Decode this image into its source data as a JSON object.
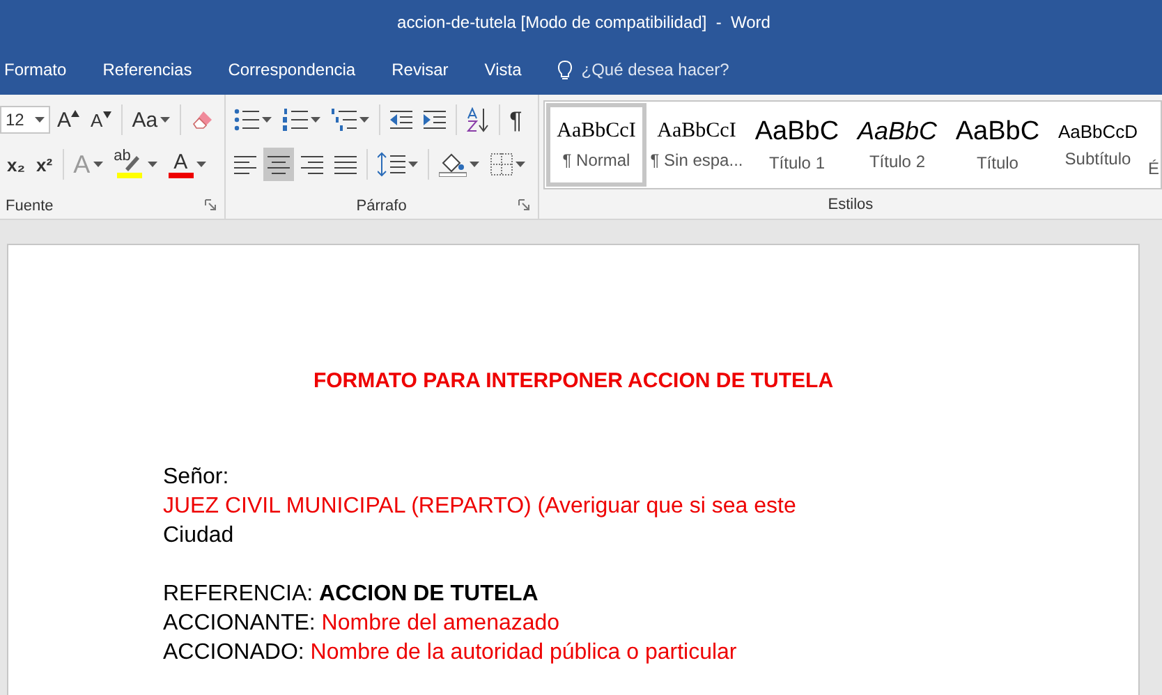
{
  "window": {
    "title": "accion-de-tutela [Modo de compatibilidad]  -  Word"
  },
  "tabs": [
    {
      "label": "Formato",
      "selected": false
    },
    {
      "label": "Referencias",
      "selected": false
    },
    {
      "label": "Correspondencia",
      "selected": false
    },
    {
      "label": "Revisar",
      "selected": false
    },
    {
      "label": "Vista",
      "selected": false
    }
  ],
  "tell_me": {
    "placeholder": "¿Qué desea hacer?"
  },
  "font_group": {
    "label": "Fuente",
    "size": "12",
    "row1": [
      {
        "kind": "grow",
        "text": "A",
        "dropdown": false
      },
      {
        "kind": "shrink",
        "text": "A",
        "dropdown": false
      },
      {
        "kind": "plain",
        "text": "Aa",
        "dropdown": true
      },
      {
        "kind": "eraser",
        "dropdown": false
      }
    ],
    "row2": [
      {
        "kind": "plain",
        "text": "x₂",
        "dropdown": false
      },
      {
        "kind": "plain",
        "text": "x²",
        "dropdown": false
      },
      {
        "kind": "effects",
        "text": "A",
        "dropdown": true,
        "disabled": true
      },
      {
        "kind": "highlight",
        "text": "ab",
        "dropdown": true
      },
      {
        "kind": "fontcolor",
        "text": "A",
        "dropdown": true
      }
    ]
  },
  "paragraph_group": {
    "label": "Párrafo",
    "row1": [
      {
        "kind": "bullets",
        "dropdown": true
      },
      {
        "kind": "numbering",
        "dropdown": true
      },
      {
        "kind": "multilevel",
        "dropdown": true
      },
      {
        "kind": "outdent",
        "dropdown": false
      },
      {
        "kind": "indent",
        "dropdown": false
      },
      {
        "kind": "sort",
        "dropdown": false
      },
      {
        "kind": "plain",
        "text": "¶",
        "dropdown": false
      }
    ],
    "alignment": [
      {
        "kind": "left",
        "selected": false
      },
      {
        "kind": "center",
        "selected": true
      },
      {
        "kind": "right",
        "selected": false
      },
      {
        "kind": "justify",
        "selected": false
      }
    ],
    "row2": [
      {
        "kind": "spacing",
        "dropdown": true
      },
      {
        "kind": "shading",
        "dropdown": true
      },
      {
        "kind": "borders",
        "dropdown": true
      }
    ]
  },
  "styles_group": {
    "label": "Estilos",
    "partial_label": "É",
    "items": [
      {
        "sample": "AaBbCcI",
        "label": "¶ Normal",
        "kind": "serif",
        "selected": true
      },
      {
        "sample": "AaBbCcI",
        "label": "¶ Sin espa...",
        "kind": "serif",
        "selected": false
      },
      {
        "sample": "AaBbC",
        "label": "Título 1",
        "kind": "heading",
        "selected": false
      },
      {
        "sample": "AaBbC",
        "label": "Título 2",
        "kind": "italic",
        "selected": false
      },
      {
        "sample": "AaBbC",
        "label": "Título",
        "kind": "title",
        "selected": false
      },
      {
        "sample": "AaBbCcD",
        "label": "Subtítulo",
        "kind": "small",
        "selected": false
      }
    ]
  },
  "document": {
    "heading": "FORMATO PARA INTERPONER ACCION DE TUTELA",
    "blocks": [
      [
        [
          {
            "text": "Señor:",
            "kind": "plain"
          }
        ],
        [
          {
            "text": "JUEZ CIVIL MUNICIPAL (REPARTO) (Averiguar que si sea este",
            "kind": "highlight"
          }
        ],
        [
          {
            "text": "Ciudad",
            "kind": "plain"
          }
        ]
      ],
      [
        [
          {
            "text": "REFERENCIA: ",
            "kind": "plain"
          },
          {
            "text": "ACCION DE TUTELA",
            "kind": "strong"
          }
        ],
        [
          {
            "text": "ACCIONANTE: ",
            "kind": "plain"
          },
          {
            "text": "Nombre del amenazado",
            "kind": "highlight"
          }
        ],
        [
          {
            "text": "ACCIONADO: ",
            "kind": "plain"
          },
          {
            "text": "Nombre de la autoridad pública o particular",
            "kind": "highlight"
          }
        ]
      ]
    ]
  }
}
